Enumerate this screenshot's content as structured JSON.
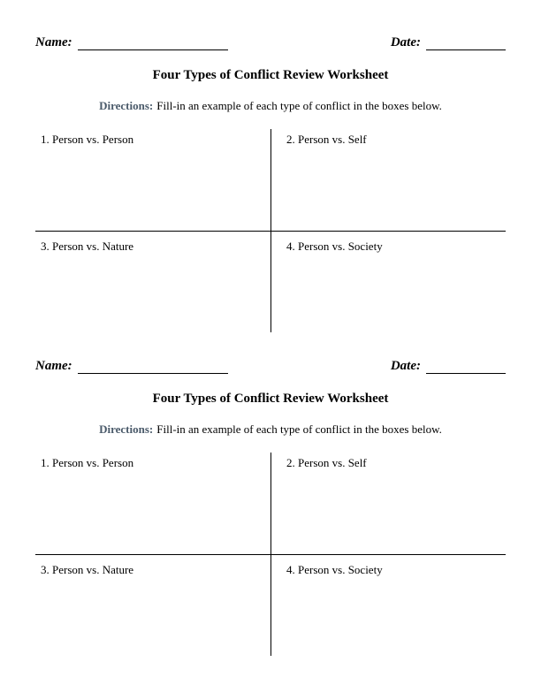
{
  "labels": {
    "name": "Name:",
    "date": "Date:",
    "directions": "Directions:"
  },
  "worksheets": [
    {
      "title": "Four Types of Conflict Review Worksheet",
      "directions_text": "Fill-in an example of each type of conflict in the boxes below.",
      "cells": {
        "c1": "1. Person vs. Person",
        "c2": "2. Person vs. Self",
        "c3": "3. Person vs. Nature",
        "c4": "4. Person vs. Society"
      }
    },
    {
      "title": "Four Types of Conflict Review Worksheet",
      "directions_text": "Fill-in an example of each type of conflict in the boxes below.",
      "cells": {
        "c1": "1. Person vs. Person",
        "c2": "2. Person vs. Self",
        "c3": "3. Person vs. Nature",
        "c4": "4. Person vs. Society"
      }
    }
  ]
}
